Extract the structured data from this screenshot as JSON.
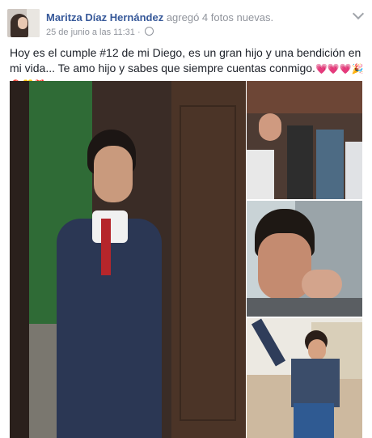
{
  "post": {
    "author": "Maritza Díaz Hernández",
    "action": " agregó 4 fotos nuevas.",
    "timestamp": "25 de junio a las 11:31",
    "separator": " · ",
    "privacy_icon": "globe-icon",
    "options_icon": "chevron-down-icon",
    "text": "Hoy es el cumple #12 de mi Diego, es un gran hijo y una bendición en mi vida... Te amo hijo y sabes que siempre cuentas conmigo.",
    "emojis": "💗💗💗🎉🎈🎊🎁"
  },
  "colors": {
    "author_link": "#365899",
    "secondary_text": "#90949c",
    "body_text": "#1d2129"
  }
}
